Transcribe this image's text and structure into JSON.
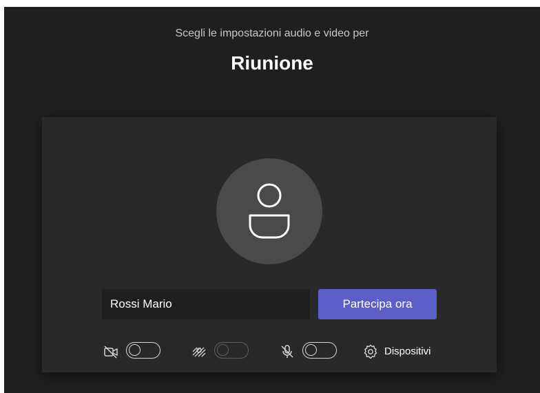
{
  "header": {
    "subtitle": "Scegli le impostazioni audio e video per",
    "title": "Riunione"
  },
  "join": {
    "name_value": "Rossi Mario",
    "join_label": "Partecipa ora"
  },
  "controls": {
    "camera": {
      "icon": "camera-off-icon",
      "on": false
    },
    "background_effects": {
      "icon": "background-blur-icon",
      "on": false,
      "disabled": true
    },
    "microphone": {
      "icon": "mic-off-icon",
      "on": false
    },
    "devices_label": "Dispositivi",
    "devices_icon": "gear-icon"
  },
  "colors": {
    "background": "#1f1f1f",
    "panel": "#292929",
    "avatar": "#4a4a4a",
    "accent": "#5b5fc7"
  }
}
